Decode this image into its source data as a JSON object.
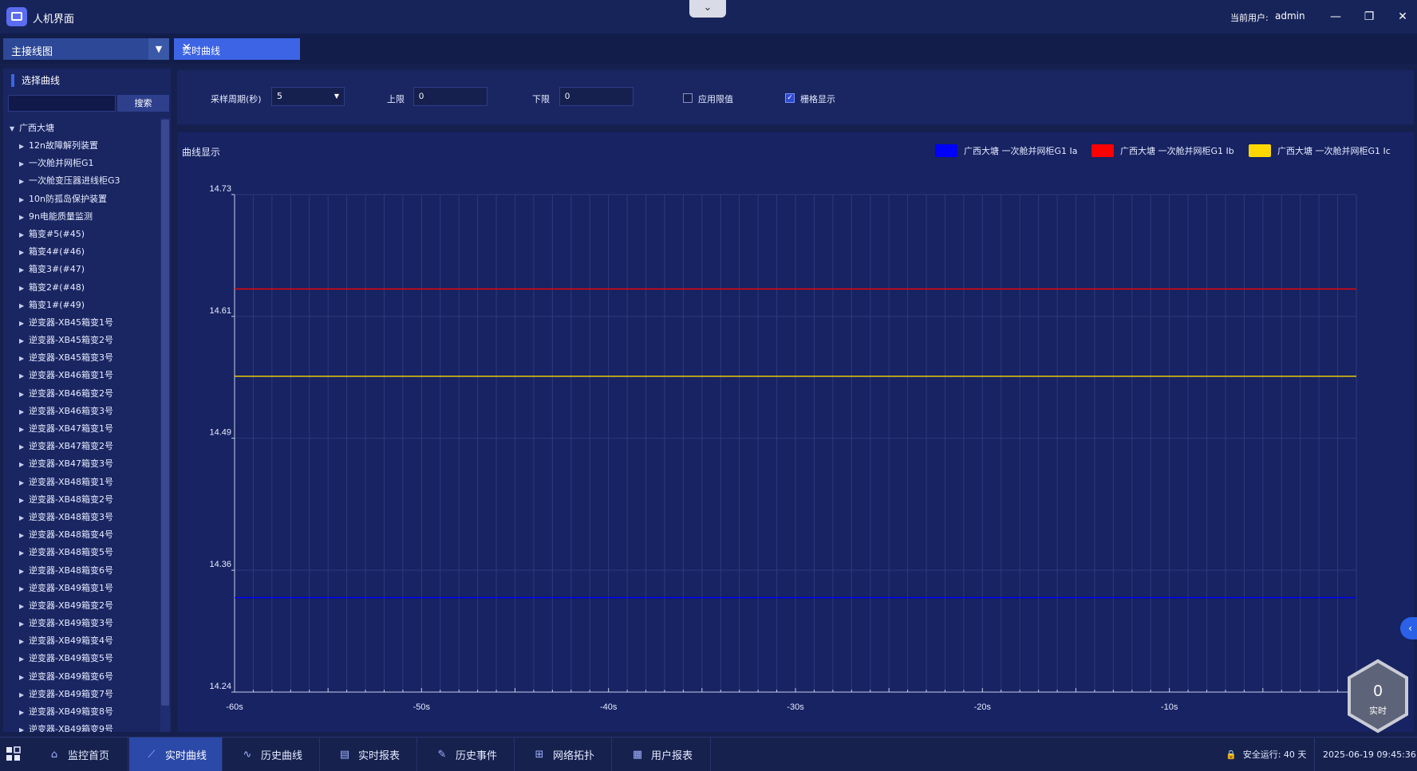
{
  "app": {
    "title": "人机界面",
    "user_label": "当前用户:",
    "user_name": "admin"
  },
  "tabs": {
    "view_select": "主接线图",
    "active_tab": "实时曲线"
  },
  "sidebar": {
    "title": "选择曲线",
    "search_placeholder": "",
    "search_button": "搜索",
    "root": "广西大塘",
    "items": [
      "12n故障解列装置",
      "一次舱并网柜G1",
      "一次舱变压器进线柜G3",
      "10n防孤岛保护装置",
      "9n电能质量监测",
      "箱变#5(#45)",
      "箱变4#(#46)",
      "箱变3#(#47)",
      "箱变2#(#48)",
      "箱变1#(#49)",
      "逆变器-XB45箱变1号",
      "逆变器-XB45箱变2号",
      "逆变器-XB45箱变3号",
      "逆变器-XB46箱变1号",
      "逆变器-XB46箱变2号",
      "逆变器-XB46箱变3号",
      "逆变器-XB47箱变1号",
      "逆变器-XB47箱变2号",
      "逆变器-XB47箱变3号",
      "逆变器-XB48箱变1号",
      "逆变器-XB48箱变2号",
      "逆变器-XB48箱变3号",
      "逆变器-XB48箱变4号",
      "逆变器-XB48箱变5号",
      "逆变器-XB48箱变6号",
      "逆变器-XB49箱变1号",
      "逆变器-XB49箱变2号",
      "逆变器-XB49箱变3号",
      "逆变器-XB49箱变4号",
      "逆变器-XB49箱变5号",
      "逆变器-XB49箱变6号",
      "逆变器-XB49箱变7号",
      "逆变器-XB49箱变8号",
      "逆变器-XB49箱变9号"
    ]
  },
  "toolbar": {
    "period_label": "采样周期(秒)",
    "period_value": "5",
    "upper_label": "上限",
    "upper_value": "0",
    "lower_label": "下限",
    "lower_value": "0",
    "apply_limit_label": "应用限值",
    "apply_limit_checked": false,
    "grid_label": "栅格显示",
    "grid_checked": true
  },
  "chart_title": "曲线显示",
  "chart_data": {
    "type": "line",
    "x": [
      -60,
      -55,
      -50,
      -45,
      -40,
      -35,
      -30,
      -25,
      -20,
      -15,
      -10,
      -5,
      0
    ],
    "x_ticks": [
      -60,
      -50,
      -40,
      -30,
      -20,
      -10
    ],
    "x_tick_labels": [
      "-60s",
      "-50s",
      "-40s",
      "-30s",
      "-20s",
      "-10s"
    ],
    "y_ticks": [
      14.24,
      14.36,
      14.49,
      14.61,
      14.73
    ],
    "y_tick_labels": [
      "14.24",
      "14.36",
      "14.49",
      "14.61",
      "14.73"
    ],
    "ylim": [
      14.24,
      14.73
    ],
    "grid": true,
    "legend_position": "top-right",
    "series": [
      {
        "name": "广西大塘 一次舱并网柜G1 Ia",
        "color": "#0000ff",
        "values": [
          14.333,
          14.333,
          14.333,
          14.333,
          14.333,
          14.333,
          14.333,
          14.333,
          14.333,
          14.333,
          14.333,
          14.333,
          14.333
        ]
      },
      {
        "name": "广西大塘 一次舱并网柜G1 Ib",
        "color": "#ff0000",
        "values": [
          14.637,
          14.637,
          14.637,
          14.637,
          14.637,
          14.637,
          14.637,
          14.637,
          14.637,
          14.637,
          14.637,
          14.637,
          14.637
        ]
      },
      {
        "name": "广西大塘 一次舱并网柜G1 Ic",
        "color": "#ffd700",
        "values": [
          14.551,
          14.551,
          14.551,
          14.551,
          14.551,
          14.551,
          14.551,
          14.551,
          14.551,
          14.551,
          14.551,
          14.551,
          14.551
        ]
      }
    ]
  },
  "badge": {
    "value": "0",
    "label": "实时"
  },
  "taskbar": {
    "items": [
      {
        "label": "监控首页",
        "icon": "home-icon"
      },
      {
        "label": "实时曲线",
        "icon": "realtime-curve-icon"
      },
      {
        "label": "历史曲线",
        "icon": "history-curve-icon"
      },
      {
        "label": "实时报表",
        "icon": "report-icon"
      },
      {
        "label": "历史事件",
        "icon": "event-icon"
      },
      {
        "label": "网络拓扑",
        "icon": "topology-icon"
      },
      {
        "label": "用户报表",
        "icon": "user-report-icon"
      }
    ],
    "safe_run": "安全运行: 40 天",
    "datetime": "2025-06-19 09:45:36"
  }
}
